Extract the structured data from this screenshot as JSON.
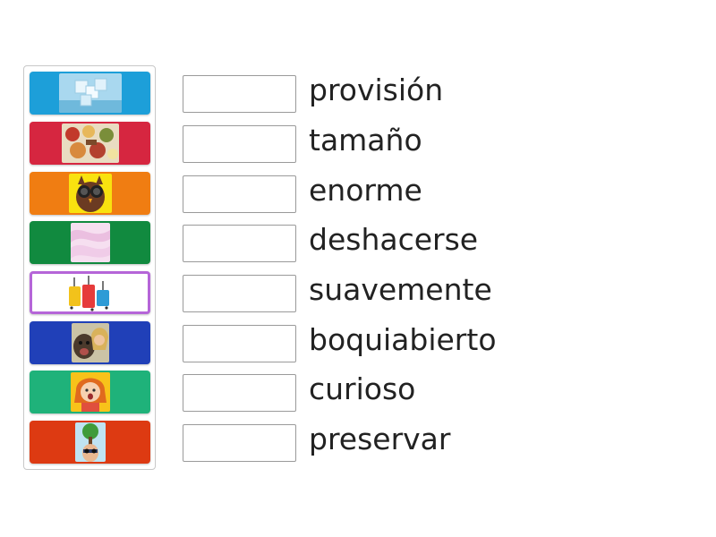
{
  "words": [
    "provisión",
    "tamaño",
    "enorme",
    "deshacerse",
    "suavemente",
    "boquiabierto",
    "curioso",
    "preservar"
  ],
  "tiles": [
    {
      "color": "#1d9fd9",
      "icon": "ice-cubes-icon"
    },
    {
      "color": "#d62640",
      "icon": "food-pile-icon"
    },
    {
      "color": "#f07d12",
      "icon": "owl-binoculars-icon"
    },
    {
      "color": "#118a3f",
      "icon": "silk-fabric-icon"
    },
    {
      "color": "#ffffff",
      "border": "#b565d8",
      "icon": "suitcases-icon"
    },
    {
      "color": "#2040b8",
      "icon": "dog-and-girl-icon"
    },
    {
      "color": "#1fb27a",
      "icon": "surprised-girl-icon"
    },
    {
      "color": "#dd3a12",
      "icon": "tree-on-head-icon"
    }
  ]
}
